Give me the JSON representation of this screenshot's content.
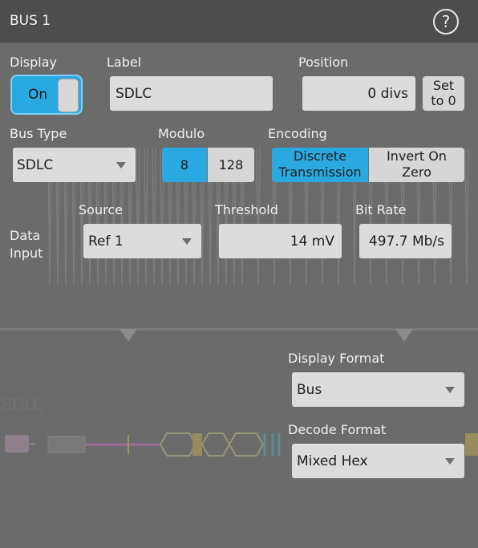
{
  "window": {
    "title": "BUS 1"
  },
  "display": {
    "label": "Display",
    "toggle_text": "On"
  },
  "label_field": {
    "label": "Label",
    "value": "SDLC"
  },
  "position": {
    "label": "Position",
    "value": "0 divs",
    "set_button": "Set\nto 0"
  },
  "bus_type": {
    "label": "Bus Type",
    "value": "SDLC"
  },
  "modulo": {
    "label": "Modulo",
    "options": [
      "8",
      "128"
    ],
    "selected": "8"
  },
  "encoding": {
    "label": "Encoding",
    "options": [
      "Discrete Transmission",
      "Invert On Zero"
    ],
    "selected": "Discrete Transmission"
  },
  "data_input": {
    "label": "Data Input",
    "source_label": "Source",
    "source_value": "Ref 1",
    "threshold_label": "Threshold",
    "threshold_value": "14 mV",
    "bitrate_label": "Bit Rate",
    "bitrate_value": "497.7 Mb/s"
  },
  "display_format": {
    "label": "Display Format",
    "value": "Bus"
  },
  "decode_format": {
    "label": "Decode Format",
    "value": "Mixed Hex"
  },
  "colors": {
    "accent": "#29a9e1",
    "panel": "#6b6b6b",
    "titlebar": "#4d4d4d"
  }
}
